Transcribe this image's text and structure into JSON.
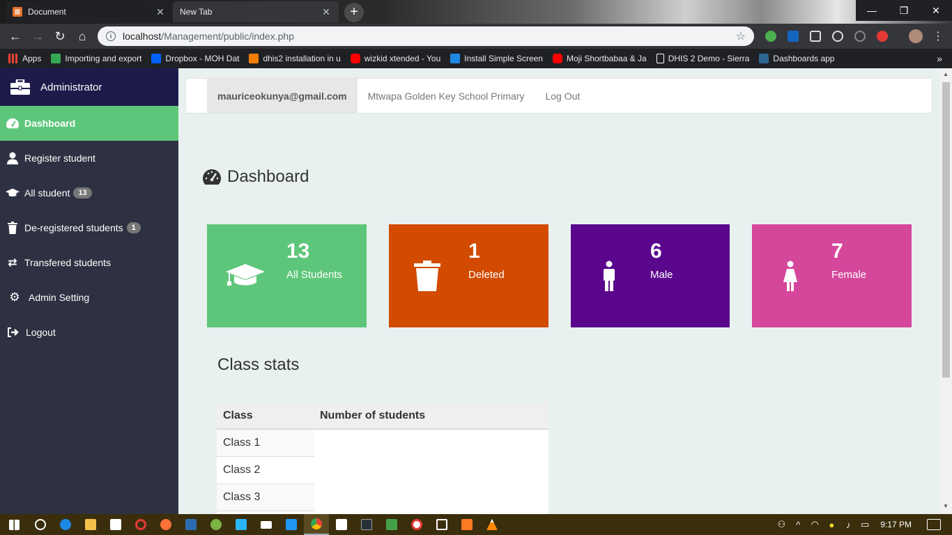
{
  "browser": {
    "tabs": [
      {
        "title": "Document",
        "icon": "xampp-icon"
      },
      {
        "title": "New Tab",
        "icon": ""
      }
    ],
    "url_host": "localhost",
    "url_path": "/Management/public/index.php",
    "bookmarks": [
      {
        "label": "Apps",
        "color": "#ea4335"
      },
      {
        "label": "Importing and export",
        "color": "#34a853"
      },
      {
        "label": "Dropbox - MOH Dat",
        "color": "#0061fe"
      },
      {
        "label": "dhis2 installation in u",
        "color": "#f57d00"
      },
      {
        "label": "wizkid xtended - You",
        "color": "#ff0000"
      },
      {
        "label": "Install Simple Screen",
        "color": "#1e88e5"
      },
      {
        "label": "Moji Shortbabaa & Ja",
        "color": "#ff0000"
      },
      {
        "label": "DHIS 2 Demo - Sierra",
        "color": "#ffffff"
      },
      {
        "label": "Dashboards app",
        "color": "#2c6693"
      }
    ]
  },
  "sidebar": {
    "header": "Administrator",
    "items": [
      {
        "label": "Dashboard",
        "icon": "tachometer-icon",
        "badge": ""
      },
      {
        "label": "Register student",
        "icon": "user-icon",
        "badge": ""
      },
      {
        "label": "All student",
        "icon": "graduation-cap-icon",
        "badge": "13"
      },
      {
        "label": "De-registered students",
        "icon": "trash-icon",
        "badge": "1"
      },
      {
        "label": "Transfered students",
        "icon": "exchange-icon",
        "badge": ""
      },
      {
        "label": "Admin Setting",
        "icon": "cogs-icon",
        "badge": ""
      },
      {
        "label": "Logout",
        "icon": "sign-out-icon",
        "badge": ""
      }
    ]
  },
  "topnav": {
    "user_email": "mauriceokunya@gmail.com",
    "school": "Mtwapa Golden Key School Primary",
    "logout": "Log Out"
  },
  "page": {
    "title": "Dashboard",
    "cards": [
      {
        "value": "13",
        "label": "All Students",
        "icon": "graduation-cap-icon",
        "color": "#5ec67a"
      },
      {
        "value": "1",
        "label": "Deleted",
        "icon": "trash-icon",
        "color": "#d24b00"
      },
      {
        "value": "6",
        "label": "Male",
        "icon": "male-icon",
        "color": "#5b078d"
      },
      {
        "value": "7",
        "label": "Female",
        "icon": "female-icon",
        "color": "#d5479b"
      }
    ],
    "class_stats": {
      "title": "Class stats",
      "columns": [
        "Class",
        "Number of students"
      ],
      "rows": [
        {
          "class": "Class 1",
          "count": ""
        },
        {
          "class": "Class 2",
          "count": ""
        },
        {
          "class": "Class 3",
          "count": ""
        }
      ]
    }
  },
  "taskbar": {
    "time": "9:17 PM"
  }
}
